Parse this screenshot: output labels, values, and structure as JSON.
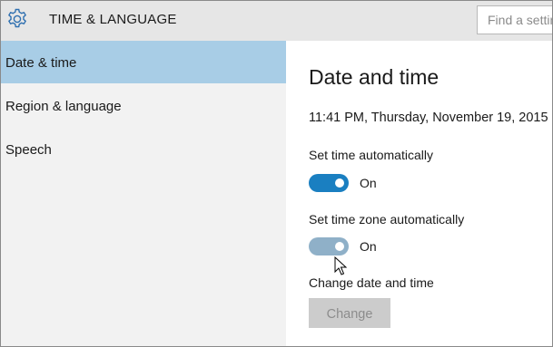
{
  "header": {
    "app_icon": "gear-icon",
    "title": "TIME & LANGUAGE",
    "search_placeholder": "Find a setting"
  },
  "sidebar": {
    "items": [
      {
        "label": "Date & time",
        "selected": true
      },
      {
        "label": "Region & language",
        "selected": false
      },
      {
        "label": "Speech",
        "selected": false
      }
    ]
  },
  "main": {
    "title": "Date and time",
    "current_datetime": "11:41 PM, Thursday, November 19, 2015",
    "settings": [
      {
        "label": "Set time automatically",
        "state": "On",
        "enabled": true,
        "color": "#1a7fc1"
      },
      {
        "label": "Set time zone automatically",
        "state": "On",
        "enabled": true,
        "color": "#8fb0c8"
      }
    ],
    "change_label": "Change date and time",
    "change_button": "Change"
  },
  "colors": {
    "accent": "#1a7fc1",
    "selected_nav": "#a8cde6",
    "sidebar_bg": "#f2f2f2",
    "header_bg": "#e6e6e6"
  }
}
